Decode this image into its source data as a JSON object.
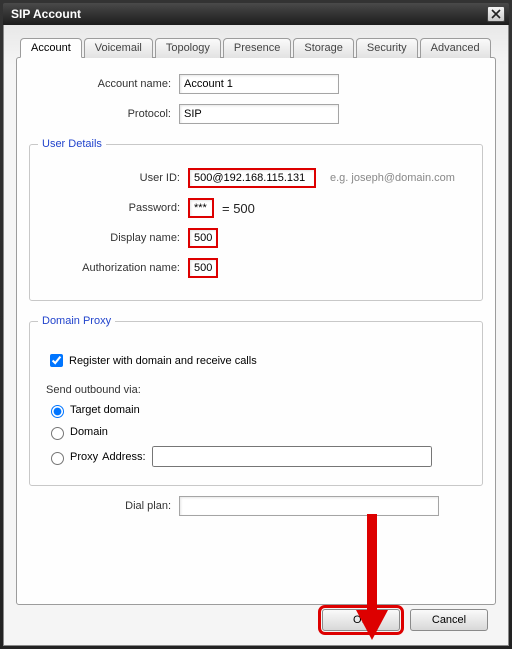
{
  "window": {
    "title": "SIP Account"
  },
  "tabs": {
    "account": "Account",
    "voicemail": "Voicemail",
    "topology": "Topology",
    "presence": "Presence",
    "storage": "Storage",
    "security": "Security",
    "advanced": "Advanced"
  },
  "labels": {
    "account_name": "Account name:",
    "protocol": "Protocol:",
    "user_details": "User Details",
    "user_id": "User ID:",
    "user_id_hint": "e.g. joseph@domain.com",
    "password": "Password:",
    "password_eq": "= 500",
    "display_name": "Display name:",
    "authorization_name": "Authorization name:",
    "domain_proxy": "Domain Proxy",
    "register_with_domain": "Register with domain and receive calls",
    "send_outbound_via": "Send outbound via:",
    "target_domain": "Target domain",
    "domain": "Domain",
    "proxy": "Proxy",
    "address": "Address:",
    "dial_plan": "Dial plan:",
    "ok": "OK",
    "cancel": "Cancel"
  },
  "values": {
    "account_name": "Account 1",
    "protocol": "SIP",
    "user_id": "500@192.168.115.131",
    "password": "***",
    "display_name": "500",
    "authorization_name": "500",
    "register_checked": true,
    "outbound": "target_domain",
    "proxy_address": "",
    "dial_plan": ""
  }
}
